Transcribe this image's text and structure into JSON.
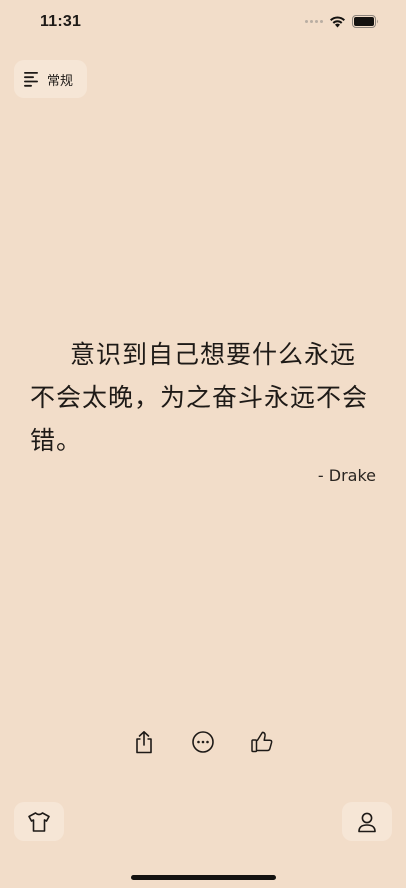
{
  "status_bar": {
    "time": "11:31"
  },
  "category": {
    "label": "常规",
    "icon": "menu-lines-icon"
  },
  "quote": {
    "text": "意识到自己想要什么永远不会太晚，为之奋斗永远不会错。",
    "author": "- Drake"
  },
  "actions": {
    "share_icon": "share-icon",
    "more_icon": "more-dots-icon",
    "like_icon": "thumbs-up-icon"
  },
  "bottom": {
    "theme_icon": "tshirt-icon",
    "profile_icon": "person-icon"
  },
  "colors": {
    "background": "#f2ddc9",
    "chip": "#f6e6d6",
    "text": "#1e1a17"
  }
}
